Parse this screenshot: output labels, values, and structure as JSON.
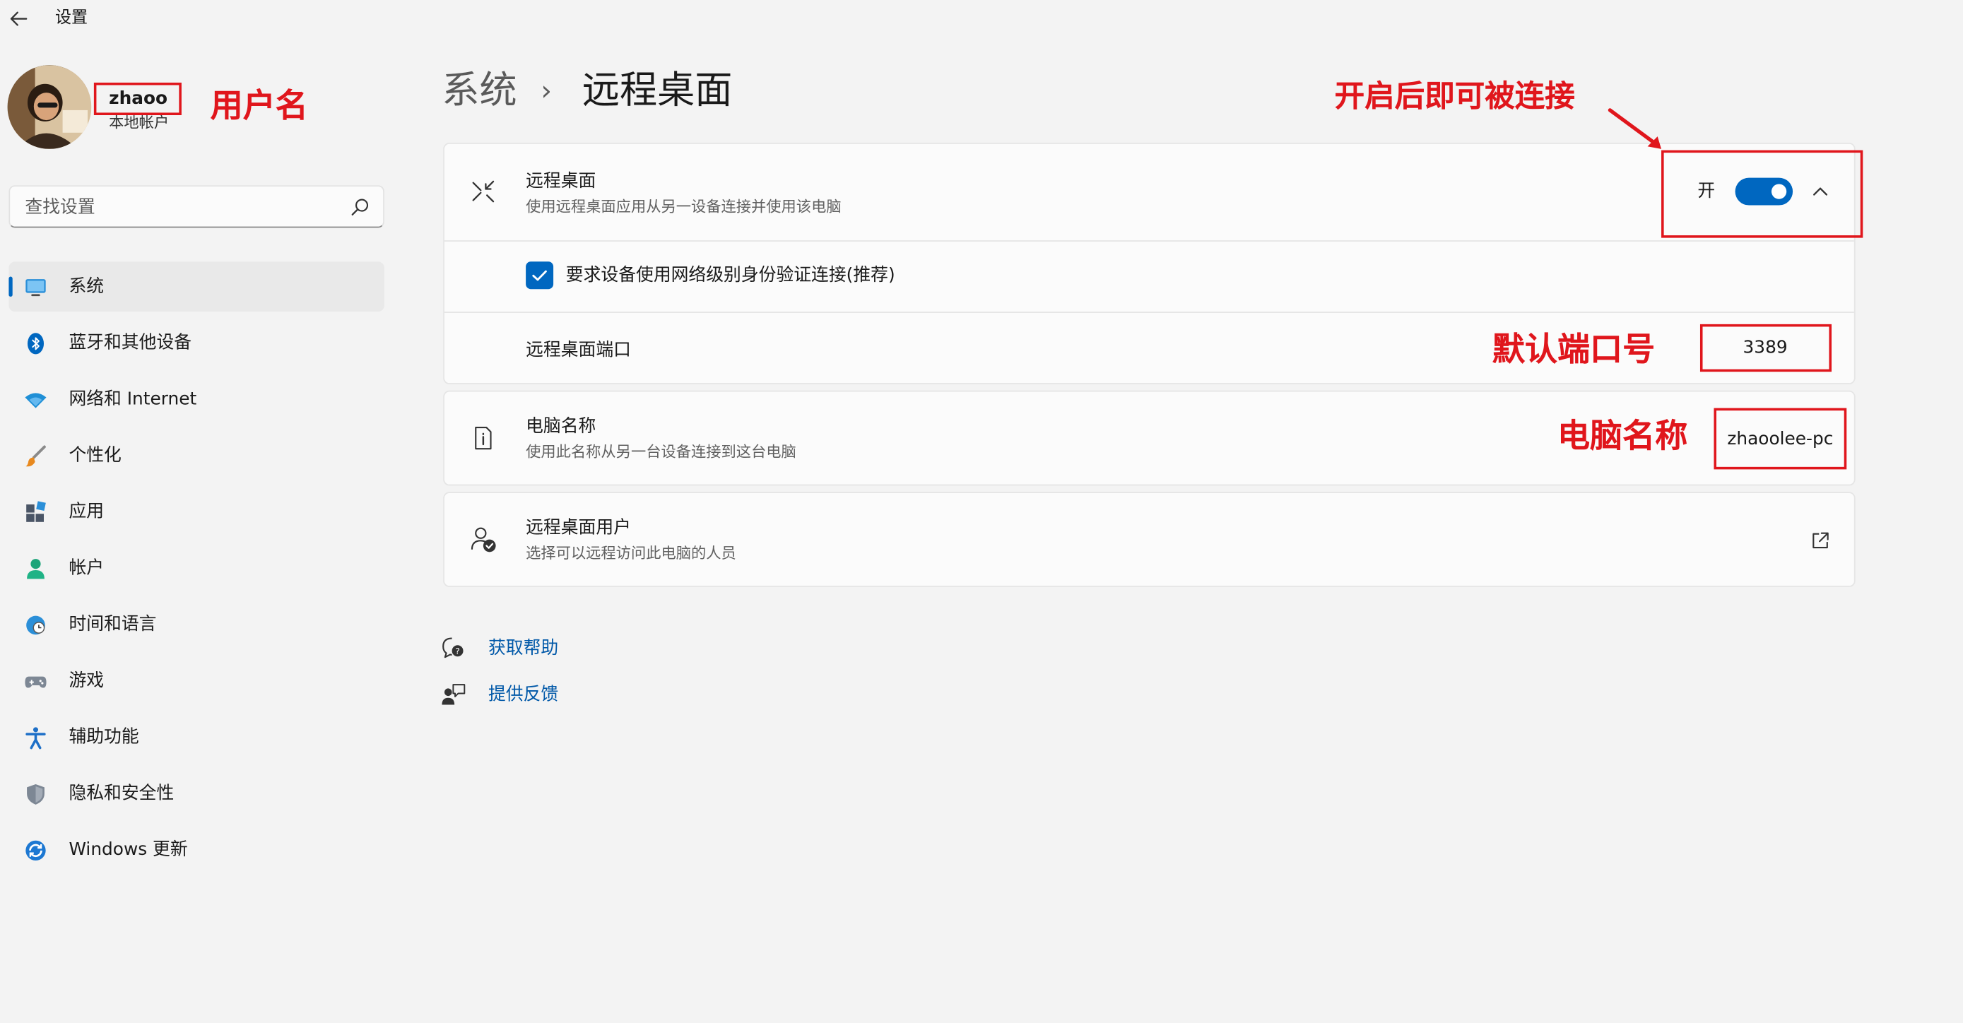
{
  "window": {
    "title": "设置"
  },
  "profile": {
    "name": "zhaoo",
    "account_type": "本地帐户"
  },
  "search": {
    "placeholder": "查找设置"
  },
  "nav": {
    "items": [
      {
        "label": "系统",
        "icon": "monitor-icon",
        "active": true
      },
      {
        "label": "蓝牙和其他设备",
        "icon": "bluetooth-icon"
      },
      {
        "label": "网络和 Internet",
        "icon": "wifi-icon"
      },
      {
        "label": "个性化",
        "icon": "brush-icon"
      },
      {
        "label": "应用",
        "icon": "apps-icon"
      },
      {
        "label": "帐户",
        "icon": "person-icon"
      },
      {
        "label": "时间和语言",
        "icon": "globe-clock-icon"
      },
      {
        "label": "游戏",
        "icon": "gamepad-icon"
      },
      {
        "label": "辅助功能",
        "icon": "accessibility-icon"
      },
      {
        "label": "隐私和安全性",
        "icon": "shield-icon"
      },
      {
        "label": "Windows 更新",
        "icon": "update-icon"
      }
    ]
  },
  "header": {
    "parent": "系统",
    "separator": "›",
    "current": "远程桌面"
  },
  "remote_desktop": {
    "title": "远程桌面",
    "description": "使用远程桌面应用从另一设备连接并使用该电脑",
    "toggle_state": "开",
    "toggle_on": true,
    "nla_label": "要求设备使用网络级别身份验证连接(推荐)",
    "nla_checked": true,
    "port_label": "远程桌面端口",
    "port_value": "3389"
  },
  "pc_name": {
    "title": "电脑名称",
    "description": "使用此名称从另一台设备连接到这台电脑",
    "value": "zhaoolee-pc"
  },
  "rd_users": {
    "title": "远程桌面用户",
    "description": "选择可以远程访问此电脑的人员"
  },
  "help": {
    "get_help": "获取帮助",
    "feedback": "提供反馈"
  },
  "annotations": {
    "username": "用户名",
    "enable": "开启后即可被连接",
    "default_port": "默认端口号",
    "pc_name": "电脑名称",
    "color": "#e0161c"
  },
  "colors": {
    "accent": "#0067c0",
    "link": "#0058a8"
  }
}
